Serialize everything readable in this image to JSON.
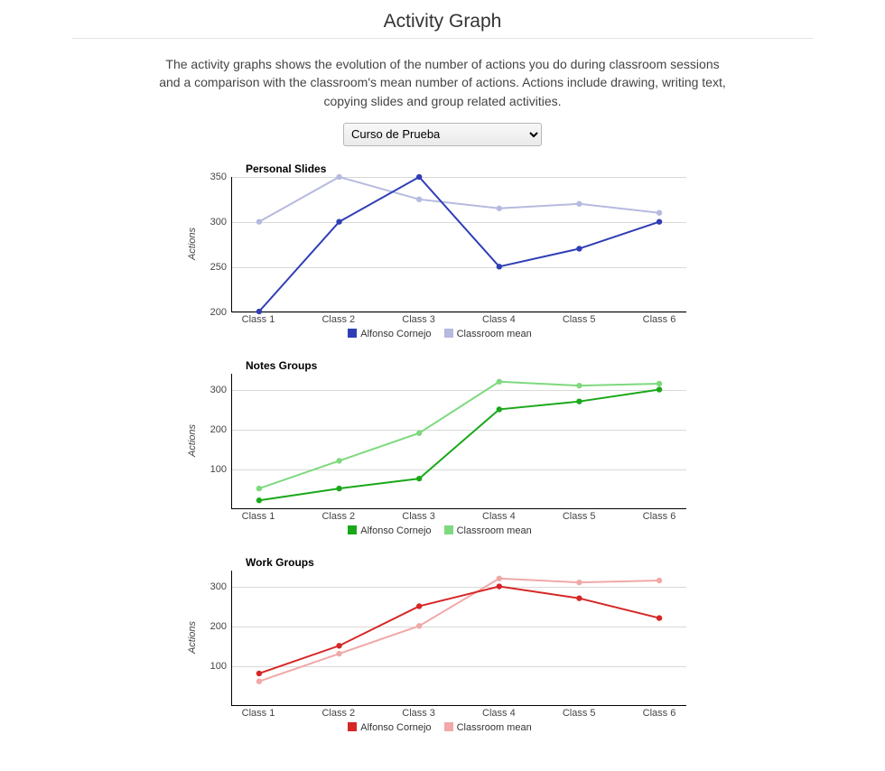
{
  "page_title": "Activity Graph",
  "description": "The activity graphs shows the evolution of the number of actions you do during classroom sessions and a comparison with the classroom's mean number of actions. Actions include drawing, writing text, copying slides and group related activities.",
  "course_select": {
    "selected": "Curso de Prueba",
    "options": [
      "Curso de Prueba"
    ]
  },
  "axis": {
    "ylabel": "Actions",
    "categories": [
      "Class 1",
      "Class 2",
      "Class 3",
      "Class 4",
      "Class 5",
      "Class 6"
    ]
  },
  "legend": {
    "user_label": "Alfonso Cornejo",
    "mean_label": "Classroom mean"
  },
  "charts": [
    {
      "key": "personal",
      "title": "Personal Slides",
      "ylim": [
        200,
        350
      ],
      "yticks": [
        200,
        250,
        300,
        350
      ],
      "colors": {
        "user": "#2f3eb5",
        "mean": "#b6badf"
      },
      "series": {
        "user": [
          200,
          300,
          350,
          250,
          270,
          300
        ],
        "mean": [
          300,
          350,
          325,
          315,
          320,
          310
        ]
      }
    },
    {
      "key": "notes",
      "title": "Notes Groups",
      "ylim": [
        0,
        340
      ],
      "yticks": [
        100,
        200,
        300
      ],
      "colors": {
        "user": "#1aa81a",
        "mean": "#7ed97e"
      },
      "series": {
        "user": [
          20,
          50,
          75,
          250,
          270,
          300
        ],
        "mean": [
          50,
          120,
          190,
          320,
          310,
          315
        ]
      }
    },
    {
      "key": "work",
      "title": "Work Groups",
      "ylim": [
        0,
        340
      ],
      "yticks": [
        100,
        200,
        300
      ],
      "colors": {
        "user": "#d62626",
        "mean": "#f1a8a8"
      },
      "series": {
        "user": [
          80,
          150,
          250,
          300,
          270,
          220
        ],
        "mean": [
          60,
          130,
          200,
          320,
          310,
          315
        ]
      }
    }
  ],
  "chart_data": [
    {
      "type": "line",
      "title": "Personal Slides",
      "xlabel": "",
      "ylabel": "Actions",
      "ylim": [
        200,
        350
      ],
      "categories": [
        "Class 1",
        "Class 2",
        "Class 3",
        "Class 4",
        "Class 5",
        "Class 6"
      ],
      "series": [
        {
          "name": "Alfonso Cornejo",
          "values": [
            200,
            300,
            350,
            250,
            270,
            300
          ]
        },
        {
          "name": "Classroom mean",
          "values": [
            300,
            350,
            325,
            315,
            320,
            310
          ]
        }
      ]
    },
    {
      "type": "line",
      "title": "Notes Groups",
      "xlabel": "",
      "ylabel": "Actions",
      "ylim": [
        0,
        340
      ],
      "categories": [
        "Class 1",
        "Class 2",
        "Class 3",
        "Class 4",
        "Class 5",
        "Class 6"
      ],
      "series": [
        {
          "name": "Alfonso Cornejo",
          "values": [
            20,
            50,
            75,
            250,
            270,
            300
          ]
        },
        {
          "name": "Classroom mean",
          "values": [
            50,
            120,
            190,
            320,
            310,
            315
          ]
        }
      ]
    },
    {
      "type": "line",
      "title": "Work Groups",
      "xlabel": "",
      "ylabel": "Actions",
      "ylim": [
        0,
        340
      ],
      "categories": [
        "Class 1",
        "Class 2",
        "Class 3",
        "Class 4",
        "Class 5",
        "Class 6"
      ],
      "series": [
        {
          "name": "Alfonso Cornejo",
          "values": [
            80,
            150,
            250,
            300,
            270,
            220
          ]
        },
        {
          "name": "Classroom mean",
          "values": [
            60,
            130,
            200,
            320,
            310,
            315
          ]
        }
      ]
    }
  ]
}
